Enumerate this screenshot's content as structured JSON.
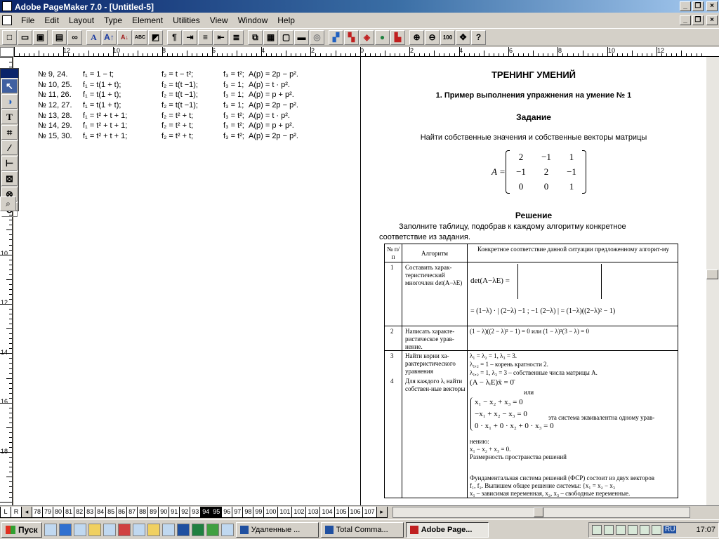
{
  "window": {
    "title": "Adobe PageMaker 7.0 - [Untitled-5]"
  },
  "menu": [
    "File",
    "Edit",
    "Layout",
    "Type",
    "Element",
    "Utilities",
    "View",
    "Window",
    "Help"
  ],
  "toolbar_icons": [
    "new-icon",
    "open-icon",
    "save-icon",
    "print-icon",
    "find-icon",
    "font-icon",
    "font-size-up-icon",
    "font-size-down-icon",
    "spell-icon",
    "fill-icon",
    "paragraph-icon",
    "indent-icon",
    "bullets-icon",
    "outdent-icon",
    "indent-right-icon",
    "styles-icon",
    "copy-icon",
    "paste-icon",
    "check-icon",
    "export-icon",
    "link-icon",
    "place-icon",
    "image-icon",
    "color-icon",
    "globe-icon",
    "pdf-icon",
    "zoom-in-icon",
    "zoom-out-icon",
    "actual-size-icon",
    "fit-icon",
    "help-icon"
  ],
  "ruler_h": [
    "12",
    "10",
    "8",
    "6",
    "4",
    "2",
    "0",
    "2",
    "4",
    "6",
    "8",
    "10",
    "12"
  ],
  "ruler_v": [
    "6",
    "8",
    "10",
    "12",
    "14",
    "16",
    "18"
  ],
  "tools": [
    "pointer-tool",
    "rotate-tool",
    "text-tool",
    "crop-tool",
    "line-tool",
    "constrained-line-tool",
    "rectangle-tool",
    "ellipse-tool",
    "polygon-tool",
    "zoom-tool"
  ],
  "left_rows": [
    [
      "№ 9, 24.",
      "f₁ = 1 − t;",
      "f₂ = t − t²;",
      "f₃ = t²;",
      "A(p) = 2p − p²."
    ],
    [
      "№ 10, 25.",
      "f₁ = t(1 + t);",
      "f₂ = t(t −1);",
      "f₃ = 1;",
      "A(p) = t · p²."
    ],
    [
      "№ 11, 26.",
      "f₁ = t(1 + t);",
      "f₂ = t(t −1);",
      "f₃ = 1;",
      "A(p) = p + p²."
    ],
    [
      "№ 12, 27.",
      "f₁ = t(1 + t);",
      "f₂ = t(t −1);",
      "f₃ = 1;",
      "A(p) = 2p − p²."
    ],
    [
      "№ 13, 28.",
      "f₁ = t² + t + 1;",
      "f₂ = t² + t;",
      "f₃ = t²;",
      "A(p) = t · p²."
    ],
    [
      "№ 14, 29.",
      "f₁ = t² + t + 1;",
      "f₂ = t² + t;",
      "f₃ = t²;",
      "A(p) = p + p²."
    ],
    [
      "№ 15, 30.",
      "f₁ = t² + t + 1;",
      "f₂ = t² + t;",
      "f₃ = t²;",
      "A(p) = 2p − p²."
    ]
  ],
  "right": {
    "heading": "ТРЕНИНГ УМЕНИЙ",
    "example": "1.  Пример выполнения упражнения на умение № 1",
    "task_label": "Задание",
    "task_text": "Найти собственные значения и собственные векторы матрицы",
    "matrix_label": "A =",
    "matrix": [
      "2",
      "−1",
      "1",
      "−1",
      "2",
      "−1",
      "0",
      "0",
      "1"
    ],
    "solution_label": "Решение",
    "solution_line1": "Заполните таблицу, подобрав к каждому алгоритму конкретное",
    "solution_line2": "соответствие из задания."
  },
  "table": {
    "h_num": "№ п/п",
    "h_algo": "Алгоритм",
    "h_match": "Конкретное соответствие данной ситуации предложенному алгорит-му",
    "r1_num": "1",
    "r1_algo": "Составить харак-теристический многочлен det(A−λE)",
    "r1_eq1": "det(A−λE) =",
    "r1_eq2": "= (1−λ) · | (2−λ)  −1 ; −1  (2−λ) | = (1−λ)((2−λ)² − 1)",
    "r2_num": "2",
    "r2_algo": "Написать характе-ристическое урав-нение.",
    "r2_eq": "(1 − λ)((2 − λ)² − 1) = 0 или (1 − λ)²(3 − λ) = 0",
    "r3_num": "3",
    "r3_algo": "Найти корни ха-рактеристического уравнения",
    "r3_l1": "λ₁ = λ₂ = 1, λ₃ = 3.",
    "r3_l2": "λ₁,₂ = 1 – корень кратности 2.",
    "r3_l3": "λ₁,₂ = 1, λ₃ = 3 – собственные числа матрицы A.",
    "r4_num": "4",
    "r4_algo": "Для каждого λᵢ найти собствен-ные векторы",
    "r4_l1": "(A − λᵢE)x̄ = 0̄",
    "r4_l2": "или",
    "r4_s1": "x₁ − x₂ + x₃ = 0",
    "r4_s2": "−x₁ + x₂ − x₃ = 0",
    "r4_s3": "0 · x₁ + 0 · x₂ + 0 · x₃ = 0",
    "r4_l3": "эта система эквивалентна одному урав-",
    "r4_l4": "нению:",
    "r4_l5": "x₁ − x₂ + x₃ = 0.",
    "r4_l6": "Размерность пространства решений",
    "r4_l7": "Фундаментальная система решений (ФСР) состоит из двух векторов",
    "r4_l8": "f₁, f₂. Выпишем общее решение системы: {x₁ = x₂ − x₃",
    "r4_l9": "x₁ – зависимая переменная, x₂, x₃ – свободные переменные."
  },
  "pages": {
    "lr": [
      "L",
      "R"
    ],
    "numbers": [
      "78",
      "79",
      "80",
      "81",
      "82",
      "83",
      "84",
      "85",
      "86",
      "87",
      "88",
      "89",
      "90",
      "91",
      "92",
      "93",
      "94",
      "95",
      "96",
      "97",
      "98",
      "99",
      "100",
      "101",
      "102",
      "103",
      "104",
      "105",
      "106",
      "107"
    ],
    "active": [
      "94",
      "95"
    ]
  },
  "taskbar": {
    "start": "Пуск",
    "tasks": [
      "Удаленные ...",
      "Total Comma...",
      "Adobe Page..."
    ],
    "clock": "17:07",
    "lang": "RU"
  }
}
